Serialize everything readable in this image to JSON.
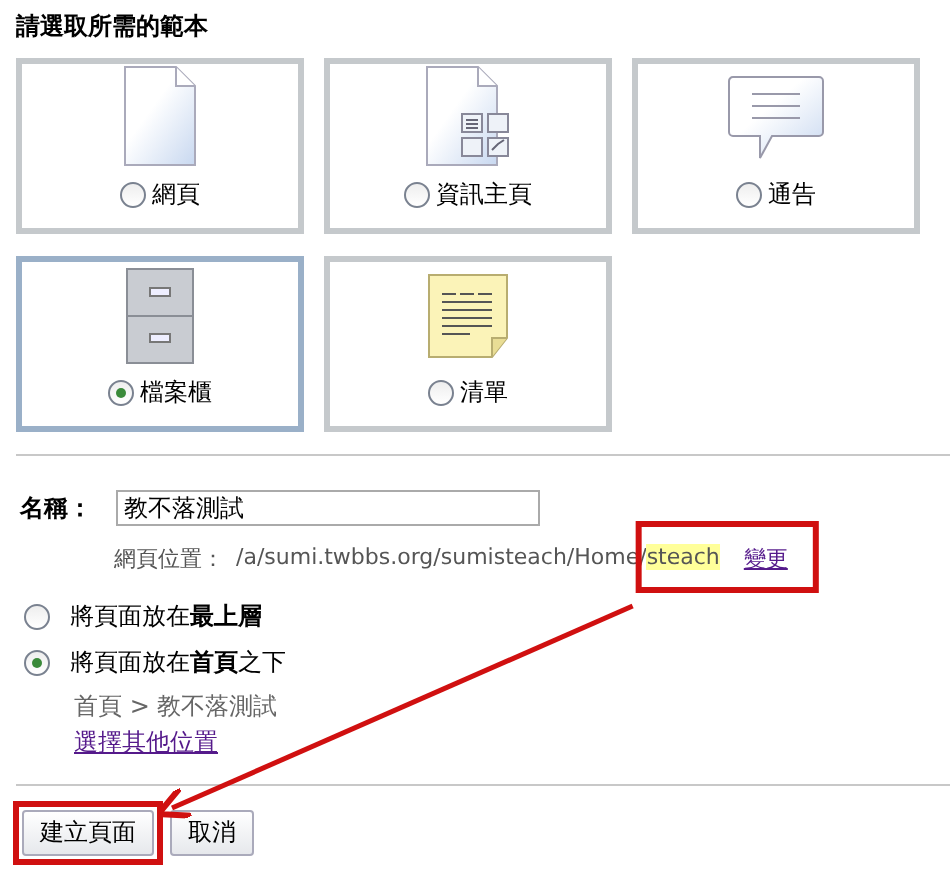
{
  "heading": "請選取所需的範本",
  "templates": [
    {
      "kind": "page",
      "label": "網頁",
      "selected": false
    },
    {
      "kind": "info",
      "label": "資訊主頁",
      "selected": false
    },
    {
      "kind": "notice",
      "label": "通告",
      "selected": false
    },
    {
      "kind": "cabinet",
      "label": "檔案櫃",
      "selected": true
    },
    {
      "kind": "list",
      "label": "清單",
      "selected": false
    }
  ],
  "name": {
    "label": "名稱：",
    "value": "教不落測試"
  },
  "url": {
    "label": "網頁位置：",
    "path": "/a/sumi.twbbs.org/sumisteach/Home/",
    "slug": "steach",
    "change_link": "變更"
  },
  "placement": [
    {
      "label": "將頁面放在**最上層**",
      "selected": false
    },
    {
      "label": "將頁面放在**首頁**之下",
      "selected": true
    }
  ],
  "breadcrumb": "首頁 > 教不落測試",
  "other_location_link": "選擇其他位置",
  "buttons": [
    {
      "label": "建立頁面"
    },
    {
      "label": "取消"
    }
  ],
  "annotations": [
    {
      "kind": "box"
    },
    {
      "kind": "box"
    },
    {
      "kind": "arrow"
    }
  ]
}
